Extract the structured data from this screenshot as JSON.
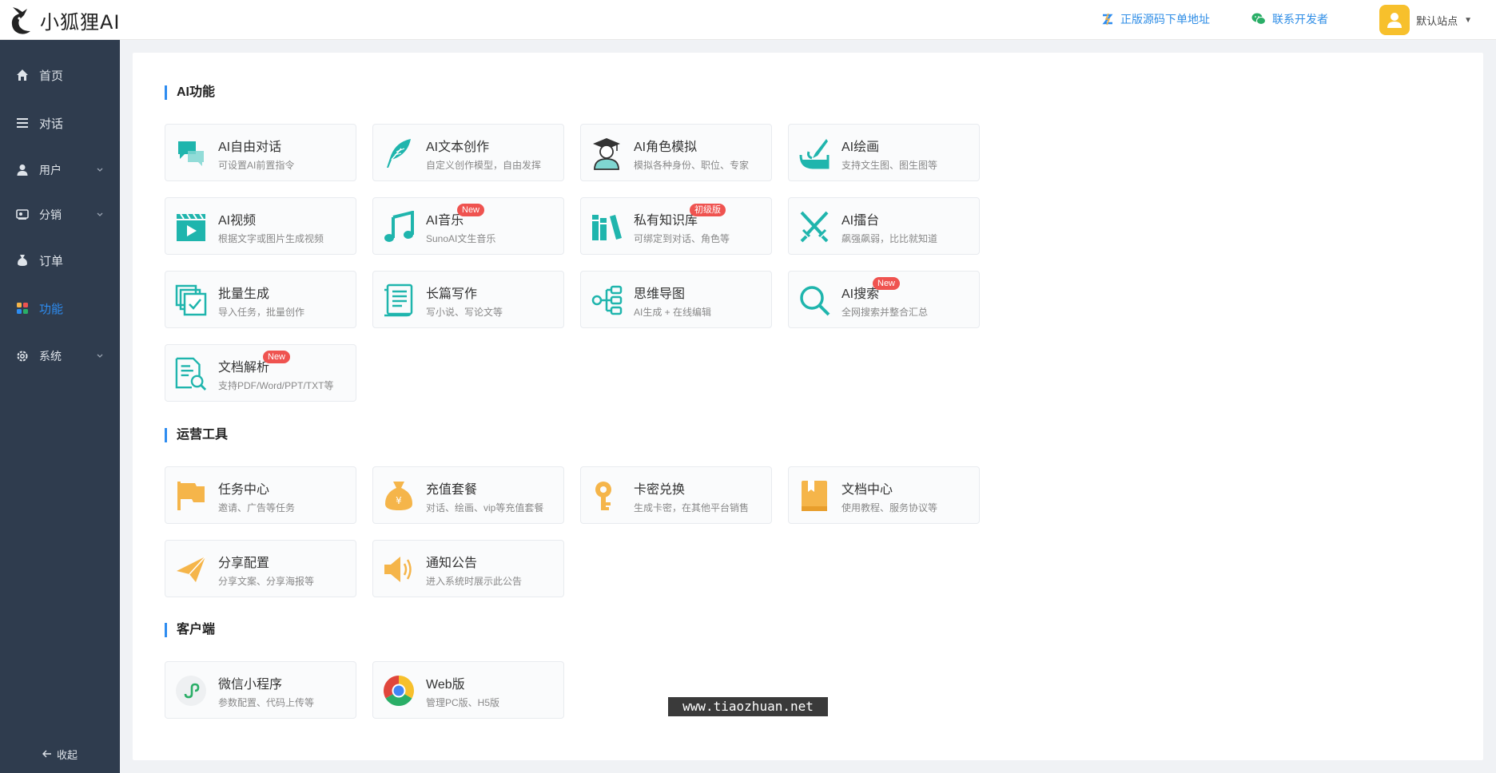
{
  "header": {
    "logo_text": "小狐狸AI",
    "link_source": "正版源码下单地址",
    "link_contact": "联系开发者",
    "user_label": "默认站点"
  },
  "sidebar": {
    "items": [
      {
        "label": "首页",
        "icon": "home-icon"
      },
      {
        "label": "对话",
        "icon": "list-icon"
      },
      {
        "label": "用户",
        "icon": "user-icon"
      },
      {
        "label": "分销",
        "icon": "distribution-icon"
      },
      {
        "label": "订单",
        "icon": "money-bag-icon"
      },
      {
        "label": "功能",
        "icon": "grid-icon",
        "active": true
      },
      {
        "label": "系统",
        "icon": "gear-icon"
      }
    ],
    "collapse_label": "收起"
  },
  "sections": {
    "ai": "AI功能",
    "ops": "运营工具",
    "client": "客户端"
  },
  "ai_cards": [
    {
      "title": "AI自由对话",
      "desc": "可设置AI前置指令",
      "icon": "chat-bubbles-icon"
    },
    {
      "title": "AI文本创作",
      "desc": "自定义创作模型，自由发挥",
      "icon": "feather-icon"
    },
    {
      "title": "AI角色模拟",
      "desc": "模拟各种身份、职位、专家",
      "icon": "graduate-icon"
    },
    {
      "title": "AI绘画",
      "desc": "支持文生图、图生图等",
      "icon": "paint-brush-icon"
    },
    {
      "title": "AI视频",
      "desc": "根据文字或图片生成视频",
      "icon": "video-icon"
    },
    {
      "title": "AI音乐",
      "desc": "SunoAI文生音乐",
      "icon": "music-note-icon",
      "badge": "New"
    },
    {
      "title": "私有知识库",
      "desc": "可绑定到对话、角色等",
      "icon": "books-icon",
      "badge": "初级版"
    },
    {
      "title": "AI擂台",
      "desc": "飙强飙弱，比比就知道",
      "icon": "crossed-swords-icon"
    },
    {
      "title": "批量生成",
      "desc": "导入任务，批量创作",
      "icon": "batch-check-icon"
    },
    {
      "title": "长篇写作",
      "desc": "写小说、写论文等",
      "icon": "document-lines-icon"
    },
    {
      "title": "思维导图",
      "desc": "AI生成 + 在线编辑",
      "icon": "mind-map-icon"
    },
    {
      "title": "AI搜索",
      "desc": "全网搜索并整合汇总",
      "icon": "search-icon",
      "badge": "New"
    },
    {
      "title": "文档解析",
      "desc": "支持PDF/Word/PPT/TXT等",
      "icon": "doc-search-icon",
      "badge": "New"
    }
  ],
  "ops_cards": [
    {
      "title": "任务中心",
      "desc": "邀请、广告等任务",
      "icon": "flag-icon"
    },
    {
      "title": "充值套餐",
      "desc": "对话、绘画、vip等充值套餐",
      "icon": "money-bag-icon"
    },
    {
      "title": "卡密兑换",
      "desc": "生成卡密，在其他平台销售",
      "icon": "key-icon"
    },
    {
      "title": "文档中心",
      "desc": "使用教程、服务协议等",
      "icon": "book-icon"
    },
    {
      "title": "分享配置",
      "desc": "分享文案、分享海报等",
      "icon": "paper-plane-icon"
    },
    {
      "title": "通知公告",
      "desc": "进入系统时展示此公告",
      "icon": "speaker-icon"
    }
  ],
  "client_cards": [
    {
      "title": "微信小程序",
      "desc": "参数配置、代码上传等",
      "icon": "mini-program-icon"
    },
    {
      "title": "Web版",
      "desc": "管理PC版、H5版",
      "icon": "chrome-icon"
    }
  ],
  "watermark": "www.tiaozhuan.net",
  "colors": {
    "sidebar_bg": "#2f3c4e",
    "accent": "#2d8cf0",
    "teal_icon": "#1fb5ad",
    "orange_icon": "#f5b54a",
    "badge_red": "#ef5350"
  }
}
